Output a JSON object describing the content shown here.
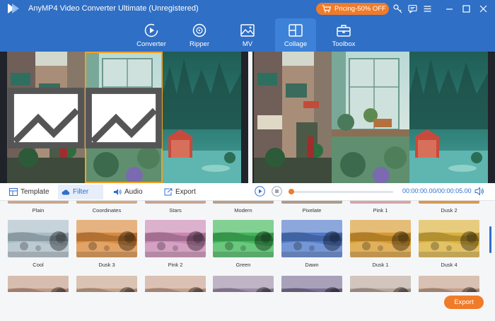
{
  "app": {
    "title": "AnyMP4 Video Converter Ultimate (Unregistered)",
    "pricing_label": "Pricing-50% OFF"
  },
  "colors": {
    "header_blue": "#2f6fc5",
    "accent_orange": "#f07b29",
    "selection_border": "#f2a020",
    "link_blue": "#2d6fcf"
  },
  "window_icons": [
    "key-icon",
    "feedback-icon",
    "menu-icon",
    "minimize-icon",
    "maximize-icon",
    "close-icon"
  ],
  "main_tabs": [
    {
      "label": "Converter",
      "icon": "converter-icon"
    },
    {
      "label": "Ripper",
      "icon": "disc-icon"
    },
    {
      "label": "MV",
      "icon": "mv-image-icon"
    },
    {
      "label": "Collage",
      "icon": "collage-grid-icon",
      "active": true
    },
    {
      "label": "Toolbox",
      "icon": "toolbox-icon"
    }
  ],
  "edit_tabs": [
    {
      "label": "Template",
      "icon": "template-icon"
    },
    {
      "label": "Filter",
      "icon": "filter-cloud-icon",
      "active": true
    },
    {
      "label": "Audio",
      "icon": "audio-icon"
    },
    {
      "label": "Export",
      "icon": "export-icon"
    }
  ],
  "playback": {
    "timecode": "00:00:00.00/00:00:05.00",
    "progress": 0.0
  },
  "filter_rows": [
    {
      "names": [
        "Plain",
        "Coordinates",
        "Stars",
        "Modern",
        "Pixelate",
        "Pink 1",
        "Dusk 2"
      ]
    },
    {
      "names": [
        "Cool",
        "Dusk 3",
        "Pink 2",
        "Green",
        "Dawn",
        "Dusk 1",
        "Dusk 4"
      ]
    }
  ],
  "export_label": "Export"
}
